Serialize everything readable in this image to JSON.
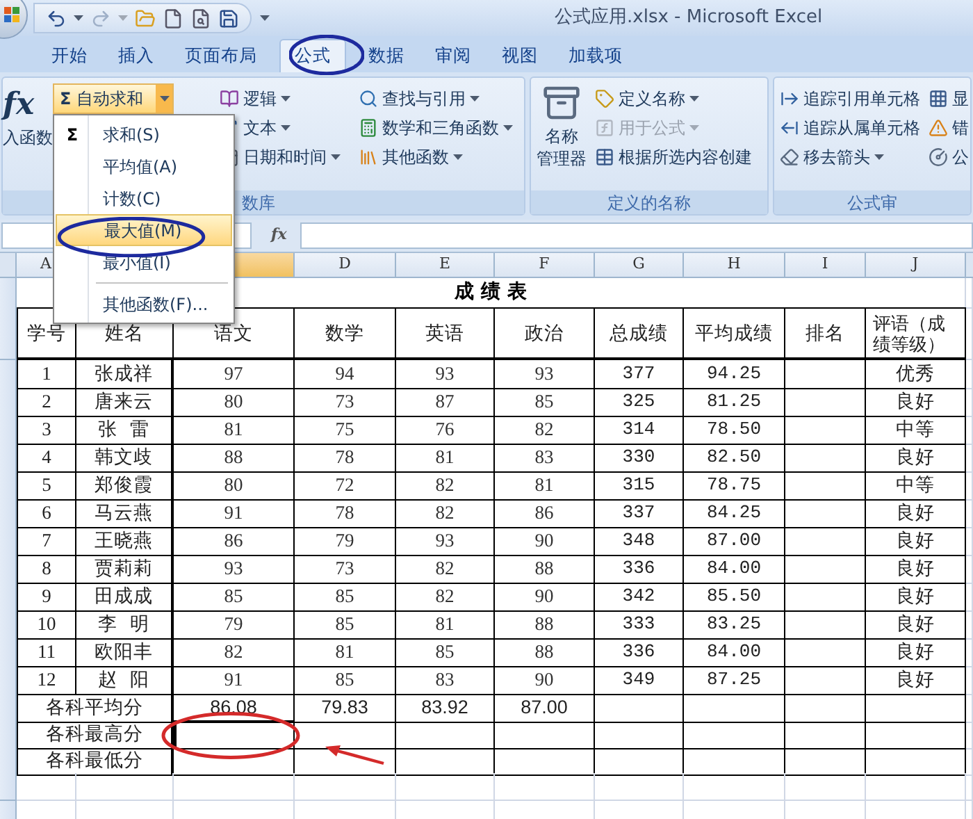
{
  "window": {
    "title": "公式应用.xlsx - Microsoft Excel"
  },
  "tabs": [
    {
      "label": "开始",
      "selected": false
    },
    {
      "label": "插入",
      "selected": false
    },
    {
      "label": "页面布局",
      "selected": false
    },
    {
      "label": "公式",
      "selected": true
    },
    {
      "label": "数据",
      "selected": false
    },
    {
      "label": "审阅",
      "selected": false
    },
    {
      "label": "视图",
      "selected": false
    },
    {
      "label": "加载项",
      "selected": false
    }
  ],
  "ribbon": {
    "insert_function": {
      "icon_char": "fx",
      "label": "入函数"
    },
    "autosum": {
      "icon_char": "Σ",
      "label": "自动求和"
    },
    "groups": [
      {
        "label": "数库",
        "columns": [
          [
            {
              "label": "逻辑",
              "dropdown": true,
              "disabled": false
            },
            {
              "label": "文本",
              "dropdown": true,
              "disabled": false
            },
            {
              "label": "日期和时间",
              "dropdown": true,
              "disabled": false
            }
          ],
          [
            {
              "label": "查找与引用",
              "dropdown": true,
              "disabled": false
            },
            {
              "label": "数学和三角函数",
              "dropdown": true,
              "disabled": false
            },
            {
              "label": "其他函数",
              "dropdown": true,
              "disabled": false
            }
          ]
        ]
      },
      {
        "label": "定义的名称",
        "big_button": [
          "名称",
          "管理器"
        ],
        "columns": [
          [
            {
              "label": "定义名称",
              "dropdown": true,
              "disabled": false
            },
            {
              "label": "用于公式",
              "dropdown": true,
              "disabled": true
            },
            {
              "label": "根据所选内容创建",
              "dropdown": false,
              "disabled": false
            }
          ]
        ]
      },
      {
        "label": "公式审",
        "columns": [
          [
            {
              "label": "追踪引用单元格",
              "dropdown": false,
              "disabled": false
            },
            {
              "label": "追踪从属单元格",
              "dropdown": false,
              "disabled": false
            },
            {
              "label": "移去箭头",
              "dropdown": true,
              "disabled": false
            }
          ],
          [
            {
              "label": "显",
              "dropdown": false,
              "disabled": false
            },
            {
              "label": "错",
              "dropdown": false,
              "disabled": false
            },
            {
              "label": "公",
              "dropdown": false,
              "disabled": false
            }
          ]
        ]
      }
    ]
  },
  "autosum_menu": [
    {
      "kind": "item",
      "icon_char": "Σ",
      "label": "求和(S)",
      "selected": false
    },
    {
      "kind": "item",
      "label": "平均值(A)",
      "selected": false
    },
    {
      "kind": "item",
      "label": "计数(C)",
      "selected": false
    },
    {
      "kind": "item",
      "label": "最大值(M)",
      "selected": true
    },
    {
      "kind": "item",
      "label": "最小值(I)",
      "selected": false
    },
    {
      "kind": "separator"
    },
    {
      "kind": "item",
      "label": "其他函数(F)...",
      "selected": false
    }
  ],
  "formula_bar": {
    "fx": "fx"
  },
  "columns": [
    {
      "label": "A",
      "selected": false
    },
    {
      "selected": true
    },
    {
      "label": "D",
      "selected": false
    },
    {
      "label": "E",
      "selected": false
    },
    {
      "label": "F",
      "selected": false
    },
    {
      "label": "G",
      "selected": false
    },
    {
      "label": "H",
      "selected": false
    },
    {
      "label": "I",
      "selected": false
    },
    {
      "label": "J",
      "selected": false
    }
  ],
  "sheet": {
    "title": "成 绩 表",
    "headers": [
      "学号",
      "姓名",
      "语文",
      "数学",
      "英语",
      "政治",
      "总成绩",
      "平均成绩",
      "排名",
      "评语（成绩等级）"
    ],
    "rows": [
      {
        "no": "1",
        "name": "张成祥",
        "scores": [
          "97",
          "94",
          "93",
          "93"
        ],
        "total": "377",
        "average": "94.25",
        "grade": "优秀"
      },
      {
        "no": "2",
        "name": "唐来云",
        "scores": [
          "80",
          "73",
          "87",
          "85"
        ],
        "total": "325",
        "average": "81.25",
        "grade": "良好"
      },
      {
        "no": "3",
        "name": "张  雷",
        "scores": [
          "81",
          "75",
          "76",
          "82"
        ],
        "total": "314",
        "average": "78.50",
        "grade": "中等"
      },
      {
        "no": "4",
        "name": "韩文歧",
        "scores": [
          "88",
          "78",
          "81",
          "83"
        ],
        "total": "330",
        "average": "82.50",
        "grade": "良好"
      },
      {
        "no": "5",
        "name": "郑俊霞",
        "scores": [
          "80",
          "72",
          "82",
          "81"
        ],
        "total": "315",
        "average": "78.75",
        "grade": "中等"
      },
      {
        "no": "6",
        "name": "马云燕",
        "scores": [
          "91",
          "78",
          "82",
          "86"
        ],
        "total": "337",
        "average": "84.25",
        "grade": "良好"
      },
      {
        "no": "7",
        "name": "王晓燕",
        "scores": [
          "86",
          "79",
          "93",
          "90"
        ],
        "total": "348",
        "average": "87.00",
        "grade": "良好"
      },
      {
        "no": "8",
        "name": "贾莉莉",
        "scores": [
          "93",
          "73",
          "82",
          "88"
        ],
        "total": "336",
        "average": "84.00",
        "grade": "良好"
      },
      {
        "no": "9",
        "name": "田成成",
        "scores": [
          "85",
          "85",
          "82",
          "90"
        ],
        "total": "342",
        "average": "85.50",
        "grade": "良好"
      },
      {
        "no": "10",
        "name": "李  明",
        "scores": [
          "79",
          "85",
          "81",
          "88"
        ],
        "total": "333",
        "average": "83.25",
        "grade": "良好"
      },
      {
        "no": "11",
        "name": "欧阳丰",
        "scores": [
          "82",
          "81",
          "85",
          "88"
        ],
        "total": "336",
        "average": "84.00",
        "grade": "良好"
      },
      {
        "no": "12",
        "name": "赵  阳",
        "scores": [
          "91",
          "85",
          "83",
          "90"
        ],
        "total": "349",
        "average": "87.25",
        "grade": "良好"
      }
    ],
    "summary": [
      {
        "label": "各科平均分",
        "values": [
          "86.08",
          "79.83",
          "83.92",
          "87.00"
        ]
      },
      {
        "label": "各科最高分"
      },
      {
        "label": "各科最低分"
      }
    ]
  },
  "annotations": [
    {
      "kind": "ellipse",
      "color": "#1d2a9e"
    },
    {
      "kind": "ellipse",
      "color": "#1d2a9e"
    },
    {
      "kind": "ellipse",
      "color": "#d42a2a"
    },
    {
      "kind": "arrow",
      "color": "#d42a2a"
    }
  ]
}
